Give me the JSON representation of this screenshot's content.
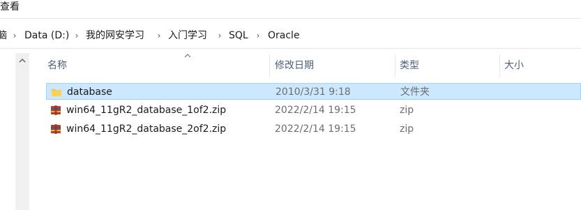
{
  "ribbon": {
    "view_tab": "查看"
  },
  "breadcrumb": {
    "items": [
      "脑",
      "Data (D:)",
      "我的网安学习",
      "入门学习",
      "SQL",
      "Oracle"
    ]
  },
  "columns": {
    "name": "名称",
    "modified": "修改日期",
    "type": "类型",
    "size": "大小"
  },
  "files": [
    {
      "name": "database",
      "modified": "2010/3/31 9:18",
      "type": "文件夹",
      "size": "",
      "icon": "folder-icon",
      "selected": true
    },
    {
      "name": "win64_11gR2_database_1of2.zip",
      "modified": "2022/2/14 19:15",
      "type": "zip",
      "size": "",
      "icon": "winrar-archive-icon",
      "selected": false
    },
    {
      "name": "win64_11gR2_database_2of2.zip",
      "modified": "2022/2/14 19:15",
      "type": "zip",
      "size": "",
      "icon": "winrar-archive-icon",
      "selected": false
    }
  ],
  "colors": {
    "selection_bg": "#cce8ff",
    "selection_border": "#99d1ff",
    "header_text": "#4c607a",
    "folder": "#f4c542"
  }
}
